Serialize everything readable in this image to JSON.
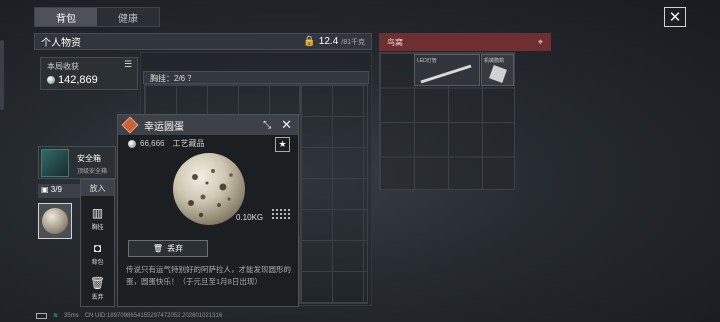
{
  "tabs": [
    "背包",
    "健康"
  ],
  "personal": {
    "title": "个人物资",
    "weight": "12.4",
    "weight_unit": "/81千克"
  },
  "bird_nest": {
    "title": "鸟窝",
    "items": [
      {
        "name": "LED灯管"
      },
      {
        "name": "机械鹦鹉"
      }
    ]
  },
  "harvest": {
    "label": "本局收获",
    "value": "142,869"
  },
  "chest": {
    "label": "胸挂：2/6 ？"
  },
  "safe_box": {
    "name": "安全箱",
    "subtitle": "顶级安全箱"
  },
  "slots": "3/9",
  "context_menu": {
    "put": "放入",
    "items": [
      {
        "label": "胸挂",
        "icon": "vest-icon"
      },
      {
        "label": "背包",
        "icon": "backpack-icon"
      },
      {
        "label": "丢弃",
        "icon": "trash-icon"
      }
    ]
  },
  "item_card": {
    "name": "幸运圆蛋",
    "value": "66,666",
    "category": "工艺藏品",
    "weight": "0.10KG",
    "drop_label": "丢弃",
    "description": "传说只有运气特别好的阿萨拉人，才能发现圆形的蛋，圆蛋快乐！（于元旦至1月8日出现）"
  },
  "footer": {
    "ping": "35ms",
    "uid": "CN UID:1897098654155297472052.202601021316"
  }
}
